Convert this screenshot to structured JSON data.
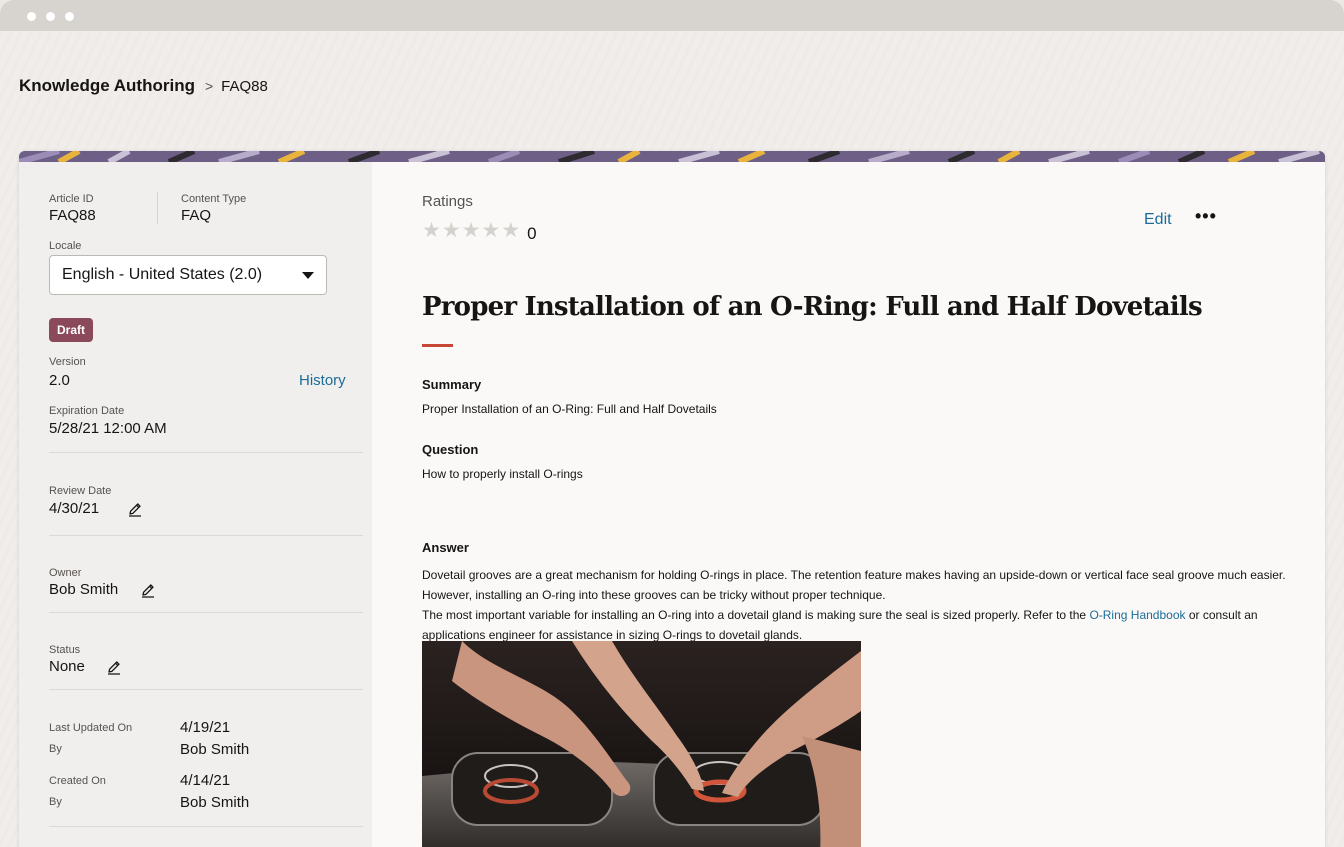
{
  "breadcrumb": {
    "root": "Knowledge Authoring",
    "separator": ">",
    "current": "FAQ88"
  },
  "sidebar": {
    "article_id_label": "Article ID",
    "article_id": "FAQ88",
    "content_type_label": "Content Type",
    "content_type": "FAQ",
    "locale_label": "Locale",
    "locale_value": "English - United States (2.0)",
    "status_badge": "Draft",
    "version_label": "Version",
    "version": "2.0",
    "history_link": "History",
    "expiration_label": "Expiration Date",
    "expiration_value": "5/28/21 12:00 AM",
    "review_label": "Review Date",
    "review_value": "4/30/21",
    "owner_label": "Owner",
    "owner_value": "Bob Smith",
    "status_label": "Status",
    "status_value": "None",
    "last_updated_label": "Last Updated On",
    "last_updated_value": "4/19/21",
    "by_label": "By",
    "last_updated_by": "Bob Smith",
    "created_label": "Created On",
    "created_value": "4/14/21",
    "created_by": "Bob Smith"
  },
  "main": {
    "ratings_label": "Ratings",
    "rating_count": "0",
    "rating_stars": 0,
    "edit_label": "Edit",
    "more_label": "•••",
    "title": "Proper Installation of an O-Ring: Full and Half Dovetails",
    "summary_heading": "Summary",
    "summary_text": "Proper Installation of an O-Ring: Full and Half Dovetails",
    "question_heading": "Question",
    "question_text": "How to properly install O-rings",
    "answer_heading": "Answer",
    "answer_p1": "Dovetail grooves are a great mechanism for holding O-rings in place. The retention feature makes having an upside-down or vertical face seal groove much easier. However, installing an O-ring into these grooves can be tricky without proper technique.",
    "answer_p2_before": "The most important variable for installing an O-ring into a dovetail gland is making sure the seal is sized properly. Refer to the ",
    "answer_link": "O-Ring Handbook",
    "answer_p2_after": " or consult an applications engineer for assistance in sizing O-rings to dovetail glands."
  },
  "colors": {
    "accent_link": "#1b6c98",
    "draft_badge": "#8b4a5c",
    "title_accent": "#c74634",
    "banner": "#6e5f86"
  }
}
